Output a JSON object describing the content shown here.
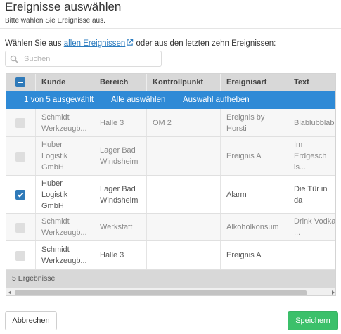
{
  "dialog": {
    "title": "Ereignisse auswählen",
    "subtitle": "Bitte wählen Sie Ereignisse aus."
  },
  "intro": {
    "prefix": "Wählen Sie aus ",
    "link_text": "allen Ereignissen",
    "suffix": " oder aus den letzten zehn Ereignissen:"
  },
  "search": {
    "placeholder": "Suchen",
    "value": ""
  },
  "table": {
    "columns": [
      "Kunde",
      "Bereich",
      "Kontrollpunkt",
      "Ereignisart",
      "Text"
    ],
    "selection": {
      "count_text": "1 von 5 ausgewählt",
      "select_all": "Alle auswählen",
      "clear": "Auswahl aufheben"
    },
    "rows": [
      {
        "checked": false,
        "disabled": true,
        "kunde": "Schmidt\nWerkzeugb...",
        "bereich": "Halle 3",
        "kontrollpunkt": "OM 2",
        "ereignisart": "Ereignis by\nHorsti",
        "text": "Blablubblab"
      },
      {
        "checked": false,
        "disabled": true,
        "kunde": "Huber\nLogistik\nGmbH",
        "bereich": "Lager Bad\nWindsheim",
        "kontrollpunkt": "",
        "ereignisart": "Ereignis A",
        "text": "Im Erdgesch\nis..."
      },
      {
        "checked": true,
        "disabled": false,
        "kunde": "Huber\nLogistik\nGmbH",
        "bereich": "Lager Bad\nWindsheim",
        "kontrollpunkt": "",
        "ereignisart": "Alarm",
        "text": "Die Tür in da"
      },
      {
        "checked": false,
        "disabled": true,
        "kunde": "Schmidt\nWerkzeugb...",
        "bereich": "Werkstatt",
        "kontrollpunkt": "",
        "ereignisart": "Alkoholkonsum",
        "text": "Drink Vodka\n..."
      },
      {
        "checked": false,
        "disabled": false,
        "kunde": "Schmidt\nWerkzeugb...",
        "bereich": "Halle 3",
        "kontrollpunkt": "",
        "ereignisart": "Ereignis A",
        "text": ""
      }
    ],
    "footer": "5 Ergebnisse"
  },
  "buttons": {
    "cancel": "Abbrechen",
    "save": "Speichern"
  },
  "colors": {
    "accent": "#2f8ad6",
    "checkbox": "#2f7ab9",
    "link": "#2a7bbf",
    "save": "#3bc06a",
    "header_bg": "#d8d8d8"
  },
  "icons": {
    "external_link": "external-link-icon",
    "search": "search-icon",
    "header_checkbox": "minus-checkbox-icon",
    "check": "check-icon"
  }
}
